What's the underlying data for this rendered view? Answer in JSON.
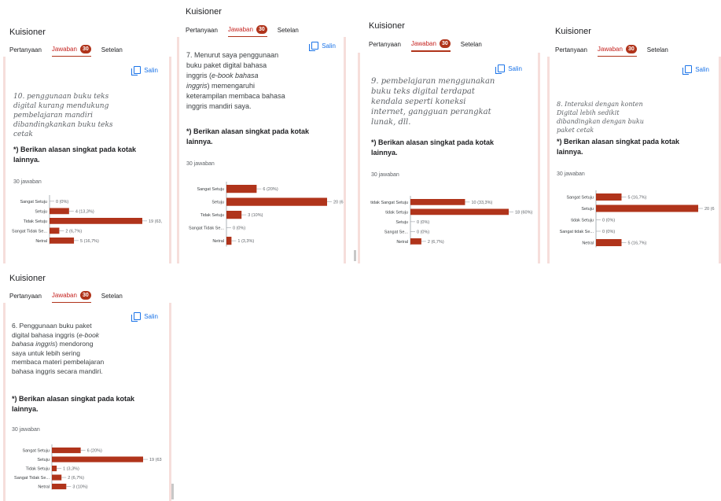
{
  "app": {
    "title": "Kuisioner",
    "tabs": [
      "Pertanyaan",
      "Jawaban",
      "Setelan"
    ],
    "response_badge": "30"
  },
  "copy_label": "Salin",
  "colors": {
    "bar": "#b0341b",
    "accent": "#c5221f",
    "link": "#1a73e8"
  },
  "panels": [
    {
      "question_parts": [
        "10. penggunaan buku teks",
        "digital kurang mendukung",
        "pembelajaran mandiri",
        "dibandingkankan buku teks",
        "cetak"
      ],
      "prompt": "*) Berikan alasan singkat pada kotak lainnya.",
      "count": "30 jawaban"
    },
    {
      "question_parts": [
        "7. Menurut saya penggunaan",
        "buku paket digital bahasa",
        "inggris (",
        "e-book bahasa",
        "inggris",
        ") memengaruhi",
        "keterampilan membaca bahasa",
        "inggris mandiri saya."
      ],
      "prompt": "*) Berikan alasan singkat pada kotak lainnya.",
      "count": "30 jawaban"
    },
    {
      "question_parts": [
        "9. pembelajaran menggunakan",
        "buku teks digital terdapat",
        "kendala seperti koneksi",
        "internet, gangguan perangkat",
        "lunak, dll."
      ],
      "prompt": "*) Berikan alasan singkat pada kotak lainnya.",
      "count": "30 jawaban"
    },
    {
      "question_parts": [
        "8. Interaksi dengan konten",
        "Digital lebih sedikit",
        "dibandingkan dengan buku",
        "paket cetak"
      ],
      "prompt": "*) Berikan alasan singkat pada kotak lainnya.",
      "count": "30 jawaban"
    },
    {
      "question_parts": [
        "6. Penggunaan  buku paket",
        "digital bahasa inggris (",
        "e-book",
        "bahasa inggris",
        ") mendorong",
        "saya untuk lebih sering",
        "membaca materi pembelajaran",
        "bahasa inggris secara mandiri."
      ],
      "prompt": "*) Berikan alasan singkat pada kotak lainnya.",
      "count": "30 jawaban"
    }
  ],
  "chart_data": [
    {
      "type": "bar",
      "orientation": "horizontal",
      "categories": [
        "Sangat Setuju",
        "Setuju",
        "Tidak Setuju",
        "Sangat Tidak Se...",
        "Netral"
      ],
      "values": [
        0,
        4,
        19,
        2,
        5
      ],
      "labels": [
        "0 (0%)",
        "4 (13,3%)",
        "19 (63,",
        "2 (6,7%)",
        "5 (16,7%)"
      ]
    },
    {
      "type": "bar",
      "orientation": "horizontal",
      "categories": [
        "Sangat Setuju",
        "Setuju",
        "Tidak Setuju",
        "Sangat Tidak Se...",
        "Netral"
      ],
      "values": [
        6,
        20,
        3,
        0,
        1
      ],
      "labels": [
        "6 (20%)",
        "20 (6",
        "3 (10%)",
        "0 (0%)",
        "1 (3,3%)"
      ]
    },
    {
      "type": "bar",
      "orientation": "horizontal",
      "categories": [
        "tidak Sangat Setuju",
        "tidak Setuju",
        "Setuju",
        "Sangat Se...",
        "Netral"
      ],
      "values": [
        10,
        18,
        0,
        0,
        2
      ],
      "labels": [
        "10 (33,3%)",
        "18 (60%)",
        "0 (0%)",
        "0 (0%)",
        "2 (6,7%)"
      ]
    },
    {
      "type": "bar",
      "orientation": "horizontal",
      "categories": [
        "Sangat Setuju",
        "Setuju",
        "tidak Setuju",
        "Sangat tidak Se...",
        "Netral"
      ],
      "values": [
        5,
        20,
        0,
        0,
        5
      ],
      "labels": [
        "5 (16,7%)",
        "20 (6",
        "0 (0%)",
        "0 (0%)",
        "5 (16,7%)"
      ]
    },
    {
      "type": "bar",
      "orientation": "horizontal",
      "categories": [
        "Sangat Setuju",
        "Setuju",
        "Tidak Setuju",
        "Sangat Tidak Se...",
        "Netral"
      ],
      "values": [
        6,
        19,
        1,
        2,
        3
      ],
      "labels": [
        "6 (20%)",
        "19 (63",
        "1 (3,3%)",
        "2 (6,7%)",
        "3 (10%)"
      ]
    }
  ]
}
